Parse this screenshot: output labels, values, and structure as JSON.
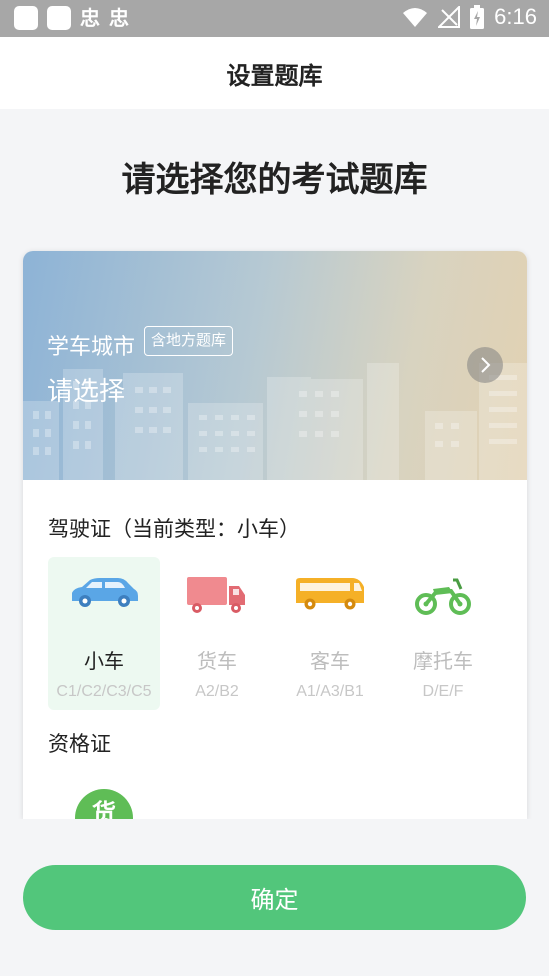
{
  "status_bar": {
    "glyph_1": "忠",
    "glyph_2": "忠",
    "time": "6:16",
    "icons": [
      "wifi-icon",
      "signal-off-icon",
      "battery-charging-icon"
    ]
  },
  "header": {
    "title": "设置题库"
  },
  "main": {
    "heading": "请选择您的考试题库",
    "city": {
      "label": "学车城市",
      "tag": "含地方题库",
      "value": "请选择",
      "arrow_icon": "chevron-right-icon"
    },
    "license_section": {
      "title": "驾驶证（当前类型：小车）"
    },
    "vehicles": [
      {
        "name": "小车",
        "codes": "C1/C2/C3/C5",
        "icon": "car-icon",
        "selected": true
      },
      {
        "name": "货车",
        "codes": "A2/B2",
        "icon": "truck-icon",
        "selected": false
      },
      {
        "name": "客车",
        "codes": "A1/A3/B1",
        "icon": "bus-icon",
        "selected": false
      },
      {
        "name": "摩托车",
        "codes": "D/E/F",
        "icon": "motorcycle-icon",
        "selected": false
      }
    ],
    "qualification_section": {
      "title": "资格证",
      "badge_char": "货"
    }
  },
  "footer": {
    "confirm_label": "确定"
  },
  "colors": {
    "primary": "#52c67b",
    "selected_bg": "#edf9f1",
    "car": "#5aa6e6",
    "truck": "#f08a8f",
    "bus": "#f5b027",
    "motorcycle": "#5fbd56"
  }
}
